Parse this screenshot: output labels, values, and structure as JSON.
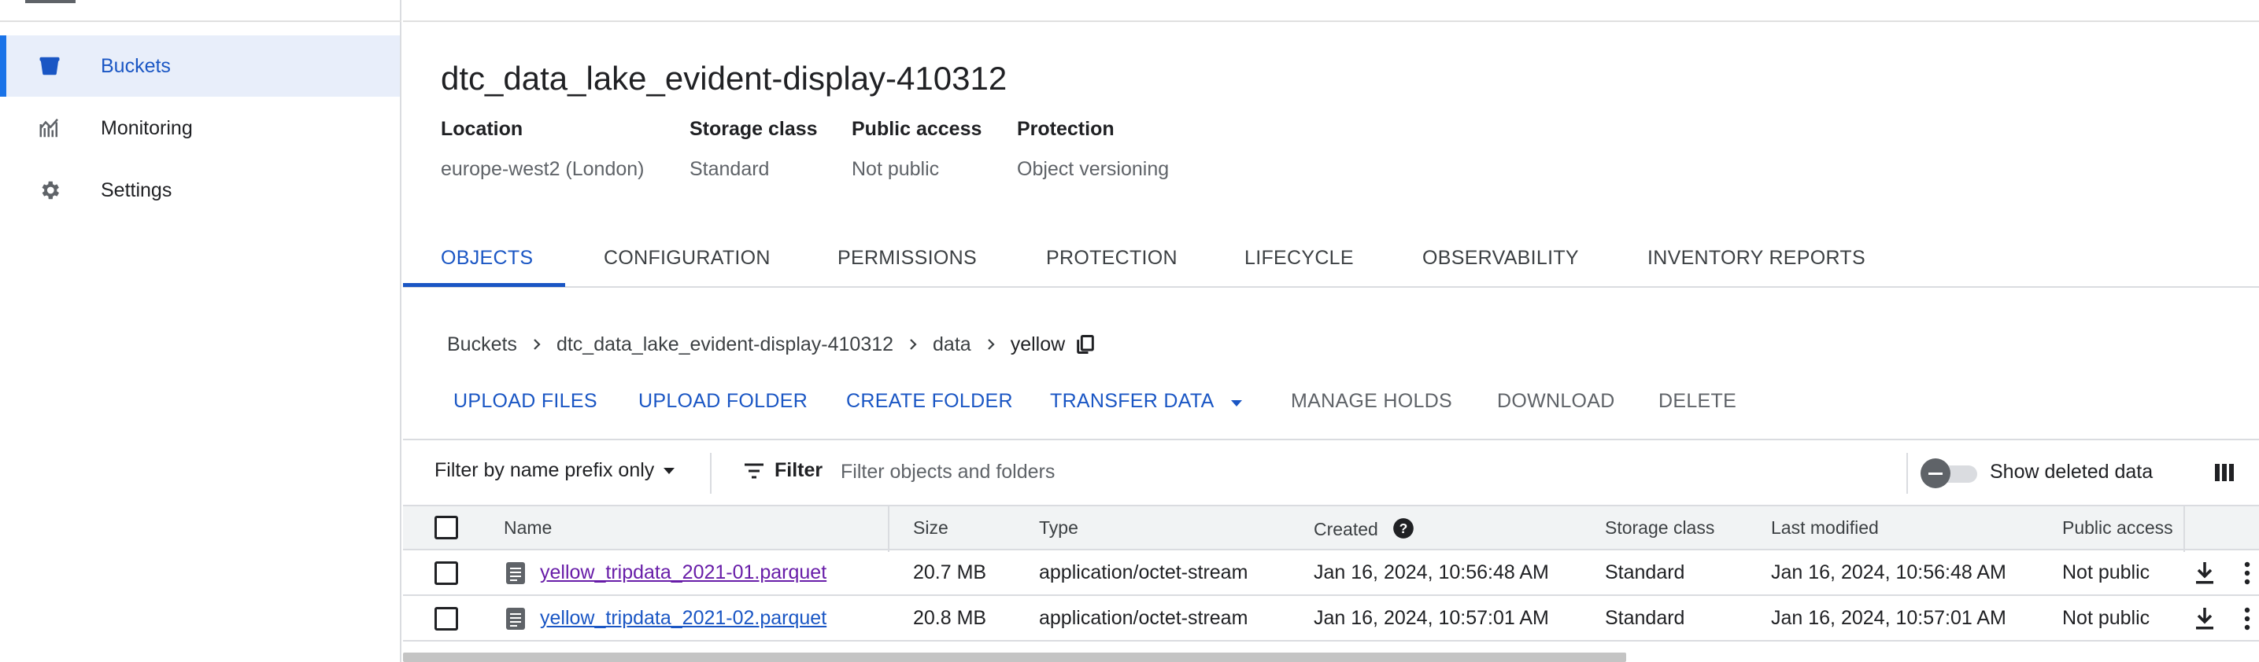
{
  "sidebar": {
    "items": [
      {
        "label": "Buckets",
        "icon": "bucket-icon",
        "active": true
      },
      {
        "label": "Monitoring",
        "icon": "chart-icon",
        "active": false
      },
      {
        "label": "Settings",
        "icon": "gear-icon",
        "active": false
      }
    ]
  },
  "bucket": {
    "title": "dtc_data_lake_evident-display-410312",
    "info": [
      {
        "key": "Location",
        "value": "europe-west2 (London)"
      },
      {
        "key": "Storage class",
        "value": "Standard"
      },
      {
        "key": "Public access",
        "value": "Not public"
      },
      {
        "key": "Protection",
        "value": "Object versioning"
      }
    ]
  },
  "tabs": [
    {
      "label": "OBJECTS",
      "active": true
    },
    {
      "label": "CONFIGURATION"
    },
    {
      "label": "PERMISSIONS"
    },
    {
      "label": "PROTECTION"
    },
    {
      "label": "LIFECYCLE"
    },
    {
      "label": "OBSERVABILITY"
    },
    {
      "label": "INVENTORY REPORTS"
    }
  ],
  "breadcrumb": [
    "Buckets",
    "dtc_data_lake_evident-display-410312",
    "data",
    "yellow"
  ],
  "actions": {
    "upload_files": "UPLOAD FILES",
    "upload_folder": "UPLOAD FOLDER",
    "create_folder": "CREATE FOLDER",
    "transfer_data": "TRANSFER DATA",
    "manage_holds": "MANAGE HOLDS",
    "download": "DOWNLOAD",
    "delete": "DELETE"
  },
  "filter": {
    "mode": "Filter by name prefix only",
    "button": "Filter",
    "placeholder": "Filter objects and folders",
    "show_deleted": "Show deleted data"
  },
  "table": {
    "headers": {
      "name": "Name",
      "size": "Size",
      "type": "Type",
      "created": "Created",
      "storage_class": "Storage class",
      "last_modified": "Last modified",
      "public_access": "Public access"
    },
    "rows": [
      {
        "name": "yellow_tripdata_2021-01.parquet",
        "size": "20.7 MB",
        "type": "application/octet-stream",
        "created": "Jan 16, 2024, 10:56:48 AM",
        "storage_class": "Standard",
        "last_modified": "Jan 16, 2024, 10:56:48 AM",
        "public_access": "Not public"
      },
      {
        "name": "yellow_tripdata_2021-02.parquet",
        "size": "20.8 MB",
        "type": "application/octet-stream",
        "created": "Jan 16, 2024, 10:57:01 AM",
        "storage_class": "Standard",
        "last_modified": "Jan 16, 2024, 10:57:01 AM",
        "public_access": "Not public"
      }
    ]
  },
  "colors": {
    "accent": "#1a56c4",
    "visited_link": "#681da8",
    "active_nav_bg": "#e8eefa"
  }
}
